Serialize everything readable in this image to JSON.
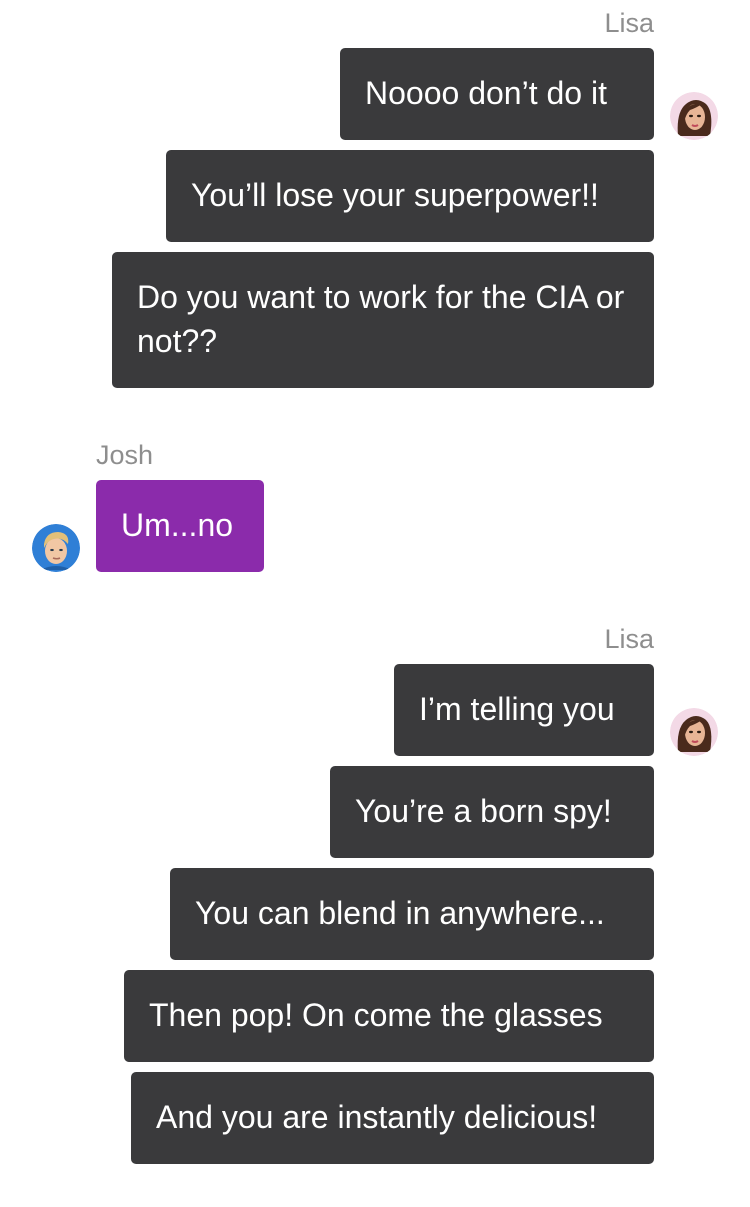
{
  "colors": {
    "lisa_bubble": "#3a3a3c",
    "josh_bubble": "#8b2bab",
    "sender_name": "#8e8e8e"
  },
  "groups": [
    {
      "sender": "Lisa",
      "avatar_icon": "lisa-avatar-icon",
      "messages": [
        "Noooo don’t do it",
        "You’ll lose your superpower!!",
        "Do you want to work for the CIA or not??"
      ]
    },
    {
      "sender": "Josh",
      "avatar_icon": "josh-avatar-icon",
      "messages": [
        "Um...no"
      ]
    },
    {
      "sender": "Lisa",
      "avatar_icon": "lisa-avatar-icon",
      "messages": [
        "I’m telling you",
        "You’re a born spy!",
        "You can blend in anywhere...",
        "Then pop! On come the glasses",
        "And you are instantly delicious!"
      ]
    }
  ]
}
